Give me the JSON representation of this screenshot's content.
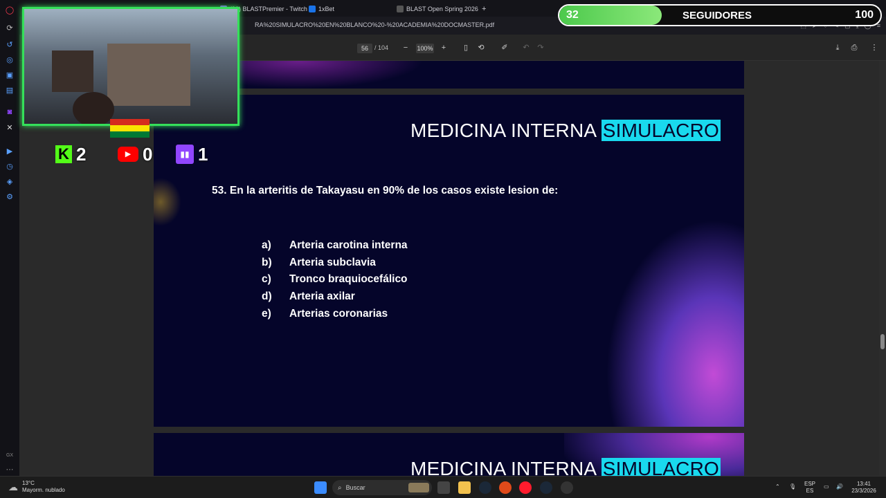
{
  "browser": {
    "tabs": [
      {
        "label": "(92) BLASTPremier - Twitch",
        "color": "#9146ff"
      },
      {
        "label": "1xBet",
        "color": "#1a73e8"
      },
      {
        "label": "BLAST Open Spring 2026",
        "color": "#333"
      }
    ],
    "new_tab": "+",
    "url": "RA%20SIMULACRO%20EN%20BLANCO%20-%20ACADEMIA%20DOCMASTER.pdf"
  },
  "pdf_toolbar": {
    "page": "56",
    "separator": "/",
    "total_pages": "104",
    "zoom": "100%"
  },
  "slides": {
    "title_main": "MEDICINA INTERNA",
    "title_highlight": "SIMULACRO",
    "question": "53. En la arteritis de Takayasu en 90% de los casos existe lesion de:",
    "options": [
      {
        "letter": "a)",
        "text": "Arteria carotina interna"
      },
      {
        "letter": "b)",
        "text": "Arteria subclavia"
      },
      {
        "letter": "c)",
        "text": "Tronco braquiocefálico"
      },
      {
        "letter": "d)",
        "text": "Arteria axilar"
      },
      {
        "letter": "e)",
        "text": "Arterias coronarias"
      }
    ]
  },
  "overlay": {
    "kick_count": "2",
    "youtube_count": "0",
    "twitch_count": "1",
    "followers_current": "32",
    "followers_label": "SEGUIDORES",
    "followers_goal": "100",
    "followers_progress": 0.32
  },
  "taskbar": {
    "temperature": "13°C",
    "weather_desc": "Mayorm. nublado",
    "search_placeholder": "Buscar",
    "lang_top": "ESP",
    "lang_bottom": "ES",
    "time": "13:41",
    "date": "23/3/2026"
  }
}
